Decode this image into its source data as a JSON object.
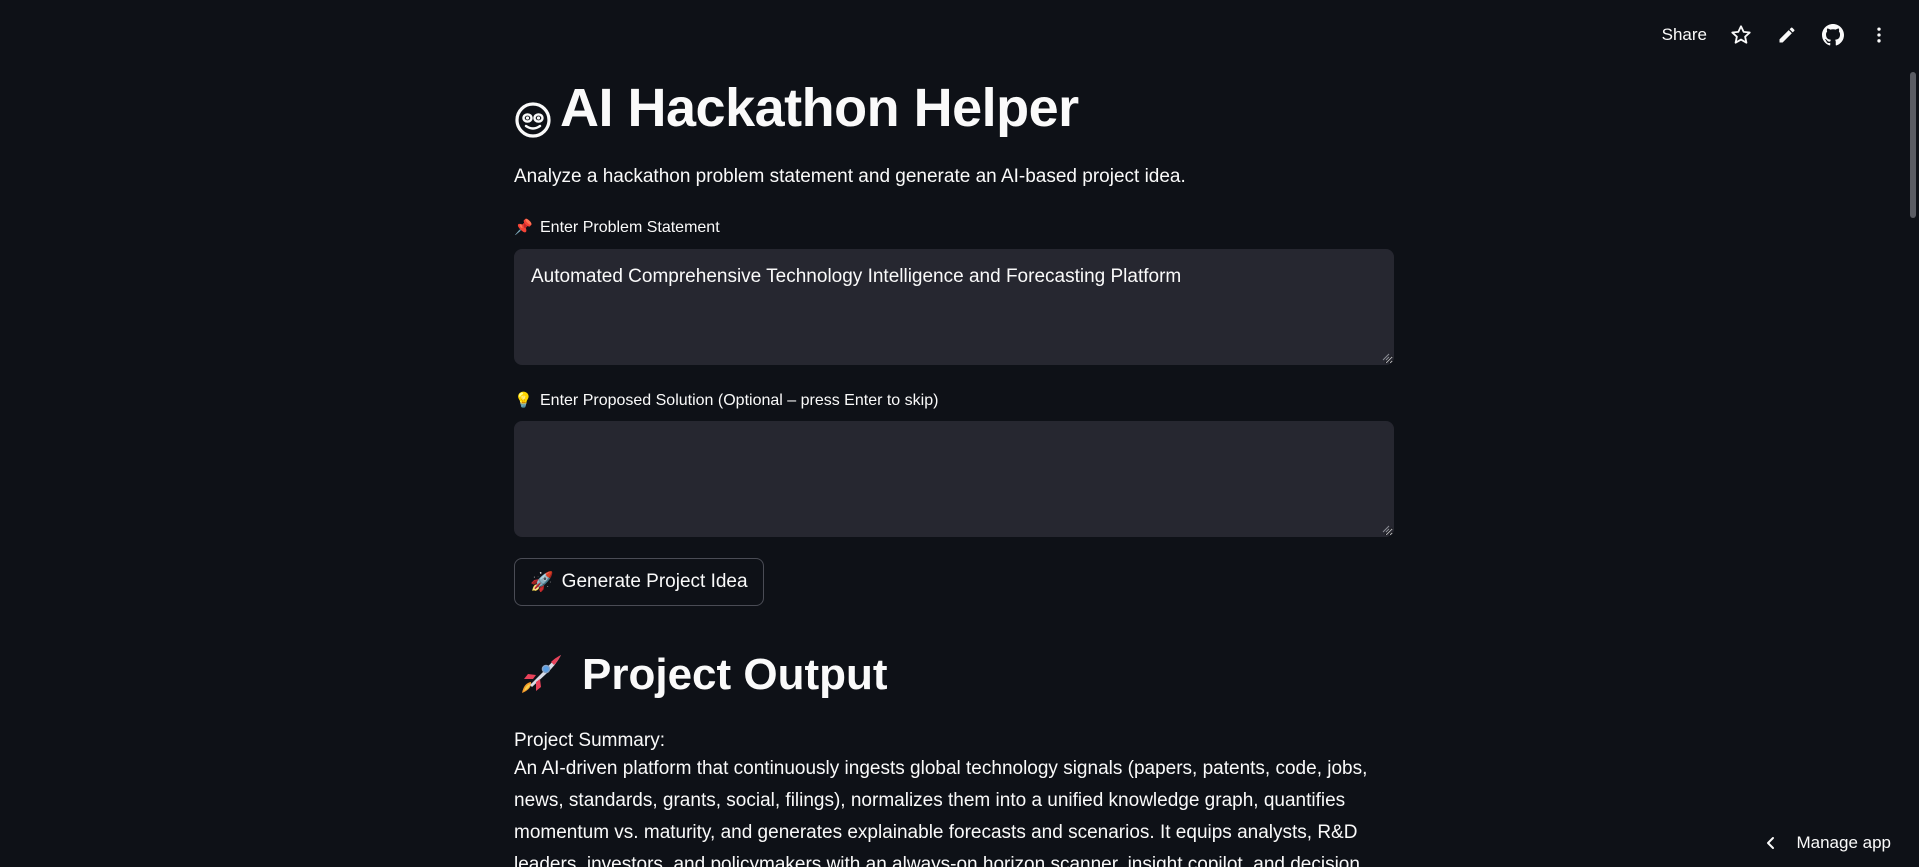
{
  "toolbar": {
    "share_label": "Share",
    "icons": [
      "star-icon",
      "pencil-icon",
      "github-icon",
      "more-vertical-icon"
    ]
  },
  "header": {
    "title": "AI Hackathon Helper",
    "title_icon": "robot-face-icon",
    "subtitle": "Analyze a hackathon problem statement and generate an AI-based project idea."
  },
  "form": {
    "problem": {
      "label_icon": "📌",
      "label": "Enter Problem Statement",
      "value": "Automated Comprehensive Technology Intelligence and Forecasting Platform",
      "placeholder": ""
    },
    "solution": {
      "label_icon": "💡",
      "label": "Enter Proposed Solution (Optional – press Enter to skip)",
      "value": "",
      "placeholder": ""
    },
    "generate_button": {
      "icon": "🚀",
      "label": "Generate Project Idea"
    }
  },
  "output": {
    "heading": "Project Output",
    "heading_icon": "rocket-icon",
    "summary_label": "Project Summary:",
    "summary_text": "An AI-driven platform that continuously ingests global technology signals (papers, patents, code, jobs, news, standards, grants, social, filings), normalizes them into a unified knowledge graph, quantifies momentum vs. maturity, and generates explainable forecasts and scenarios. It equips analysts, R&D leaders, investors, and policymakers with an always-on horizon scanner, insight copilot, and decision"
  },
  "footer": {
    "manage_label": "Manage app"
  },
  "colors": {
    "background": "#0e1117",
    "input_background": "#262730",
    "text": "#fafafa",
    "button_border": "#4a4c55"
  }
}
